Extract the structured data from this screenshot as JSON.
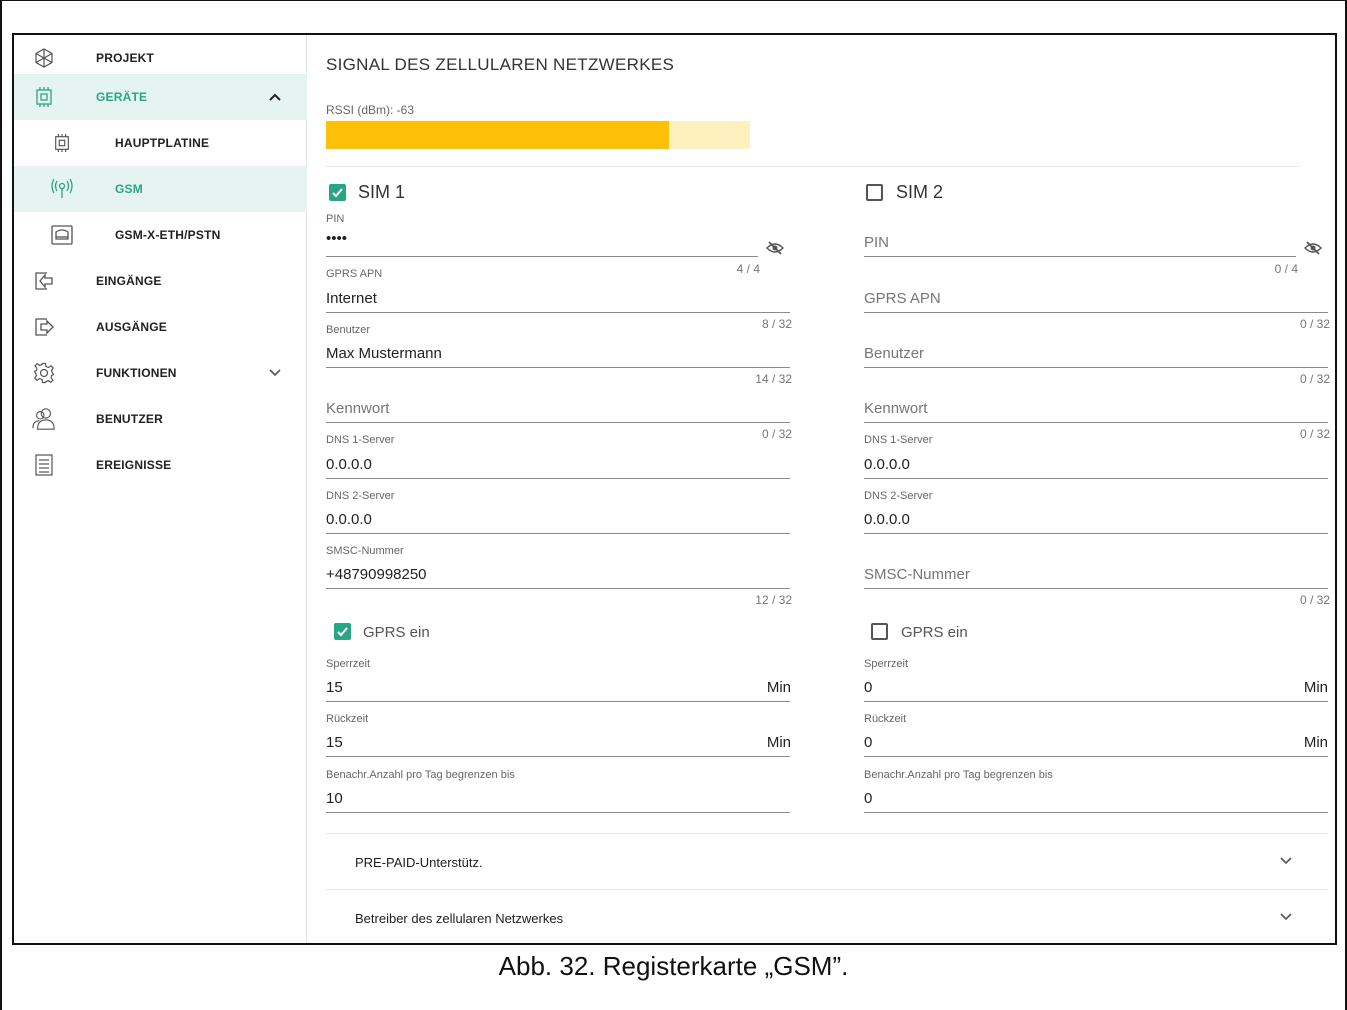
{
  "sidebar": {
    "items": [
      {
        "label": "PROJEKT"
      },
      {
        "label": "GERÄTE"
      },
      {
        "label": "HAUPTPLATINE"
      },
      {
        "label": "GSM"
      },
      {
        "label": "GSM-X-ETH/PSTN"
      },
      {
        "label": "EINGÄNGE"
      },
      {
        "label": "AUSGÄNGE"
      },
      {
        "label": "FUNKTIONEN"
      },
      {
        "label": "BENUTZER"
      },
      {
        "label": "EREIGNISSE"
      }
    ]
  },
  "main": {
    "title": "SIGNAL DES ZELLULAREN NETZWERKES",
    "rssi_label": "RSSI (dBm): -63",
    "signal_level_percent": 81,
    "sim1": {
      "title": "SIM 1",
      "checked": true,
      "pin_label": "PIN",
      "pin_value": "••••",
      "pin_count": "4 / 4",
      "apn_label": "GPRS APN",
      "apn_value": "Internet",
      "apn_count": "8 / 32",
      "user_label": "Benutzer",
      "user_value": "Max Mustermann",
      "user_count": "14 / 32",
      "password_placeholder": "Kennwort",
      "password_count": "0 / 32",
      "dns1_label": "DNS 1-Server",
      "dns1_value": "0.0.0.0",
      "dns2_label": "DNS 2-Server",
      "dns2_value": "0.0.0.0",
      "smsc_label": "SMSC-Nummer",
      "smsc_value": "+48790998250",
      "smsc_count": "12 / 32",
      "gprs_label": "GPRS ein",
      "gprs_checked": true,
      "sperrzeit_label": "Sperrzeit",
      "sperrzeit_value": "15",
      "sperrzeit_unit": "Min",
      "rueckzeit_label": "Rückzeit",
      "rueckzeit_value": "15",
      "rueckzeit_unit": "Min",
      "limit_label": "Benachr.Anzahl pro Tag begrenzen bis",
      "limit_value": "10"
    },
    "sim2": {
      "title": "SIM 2",
      "checked": false,
      "pin_placeholder": "PIN",
      "pin_count": "0 / 4",
      "apn_placeholder": "GPRS APN",
      "apn_count": "0 / 32",
      "user_placeholder": "Benutzer",
      "user_count": "0 / 32",
      "password_placeholder": "Kennwort",
      "password_count": "0 / 32",
      "dns1_label": "DNS 1-Server",
      "dns1_value": "0.0.0.0",
      "dns2_label": "DNS 2-Server",
      "dns2_value": "0.0.0.0",
      "smsc_placeholder": "SMSC-Nummer",
      "smsc_count": "0 / 32",
      "gprs_label": "GPRS ein",
      "gprs_checked": false,
      "sperrzeit_label": "Sperrzeit",
      "sperrzeit_value": "0",
      "sperrzeit_unit": "Min",
      "rueckzeit_label": "Rückzeit",
      "rueckzeit_value": "0",
      "rueckzeit_unit": "Min",
      "limit_label": "Benachr.Anzahl pro Tag begrenzen bis",
      "limit_value": "0"
    },
    "accordions": [
      {
        "label": "PRE-PAID-Unterstütz."
      },
      {
        "label": "Betreiber des zellularen Netzwerkes"
      }
    ]
  },
  "caption": "Abb. 32. Registerkarte „GSM”.",
  "colors": {
    "accent": "#2aa584",
    "signal": "#ffc107",
    "signal_bg": "#fff0bf",
    "active_bg": "#e6f4f1"
  }
}
